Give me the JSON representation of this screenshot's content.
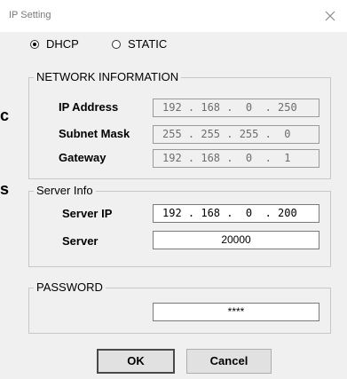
{
  "window": {
    "title": "IP Setting"
  },
  "edge_chars": [
    "c",
    "s"
  ],
  "mode": {
    "dhcp_label": "DHCP",
    "static_label": "STATIC",
    "selected": "DHCP"
  },
  "network": {
    "legend": "NETWORK INFORMATION",
    "ip_label": "IP Address",
    "ip_value": "192 . 168 .  0  . 250",
    "subnet_label": "Subnet Mask",
    "subnet_value": "255 . 255 . 255 .  0",
    "gateway_label": "Gateway",
    "gateway_value": "192 . 168 .  0  .  1"
  },
  "server": {
    "legend": "Server Info",
    "ip_label": "Server IP",
    "ip_value": "192 . 168 .  0  . 200",
    "port_label": "Server",
    "port_value": "20000"
  },
  "password": {
    "legend": "PASSWORD",
    "value": "****"
  },
  "buttons": {
    "ok": "OK",
    "cancel": "Cancel"
  }
}
